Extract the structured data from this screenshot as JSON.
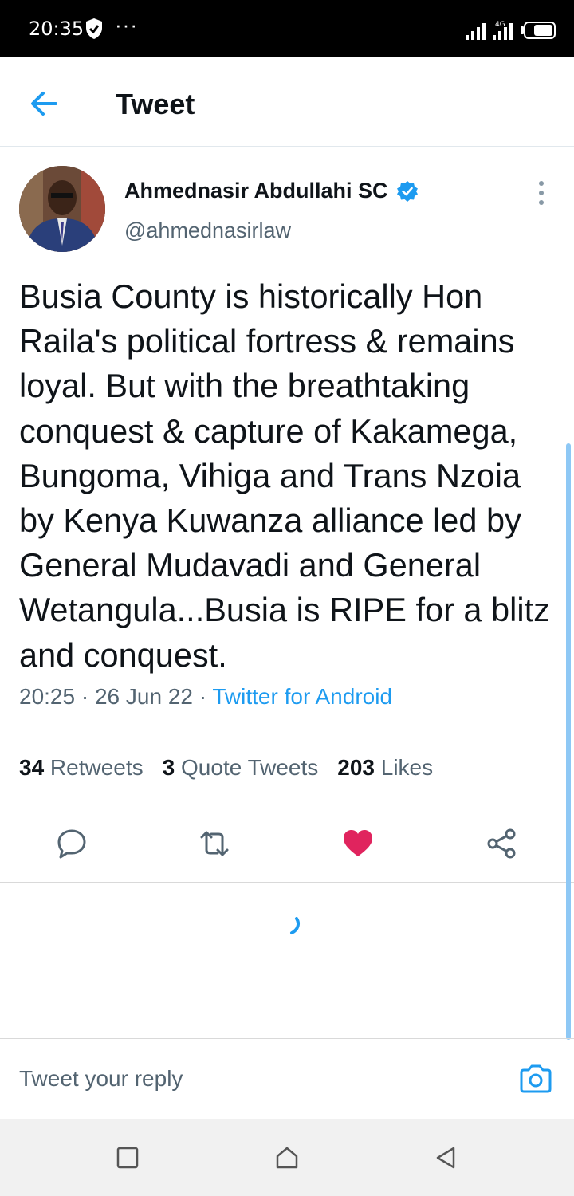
{
  "status_bar": {
    "time": "20:35",
    "dots": "···",
    "network": "4G"
  },
  "header": {
    "title": "Tweet"
  },
  "author": {
    "name": "Ahmednasir Abdullahi SC",
    "handle": "@ahmednasirlaw",
    "verified": true
  },
  "tweet": {
    "text": "Busia County is historically Hon Raila's political fortress & remains loyal. But with the breathtaking conquest & capture of Kakamega, Bungoma, Vihiga and Trans Nzoia by Kenya Kuwanza alliance led by General Mudavadi and General Wetangula...Busia is RIPE for a blitz and conquest.",
    "time": "20:25",
    "separator": " · ",
    "date": "26 Jun 22",
    "source": "Twitter for Android"
  },
  "stats": {
    "retweets_count": "34",
    "retweets_label": " Retweets",
    "quotes_count": "3",
    "quotes_label": " Quote Tweets",
    "likes_count": "203",
    "likes_label": " Likes"
  },
  "actions": {
    "liked": true,
    "like_color": "#e0245e",
    "icon_color": "#536471"
  },
  "reply": {
    "placeholder": "Tweet your reply"
  },
  "colors": {
    "accent": "#1d9bf0",
    "text": "#0f1419",
    "secondary": "#536471"
  },
  "icons": [
    "back-arrow-icon",
    "verified-icon",
    "more-vertical-icon",
    "reply-icon",
    "retweet-icon",
    "heart-icon",
    "share-icon",
    "camera-icon",
    "square-icon",
    "home-icon",
    "back-triangle-icon"
  ]
}
